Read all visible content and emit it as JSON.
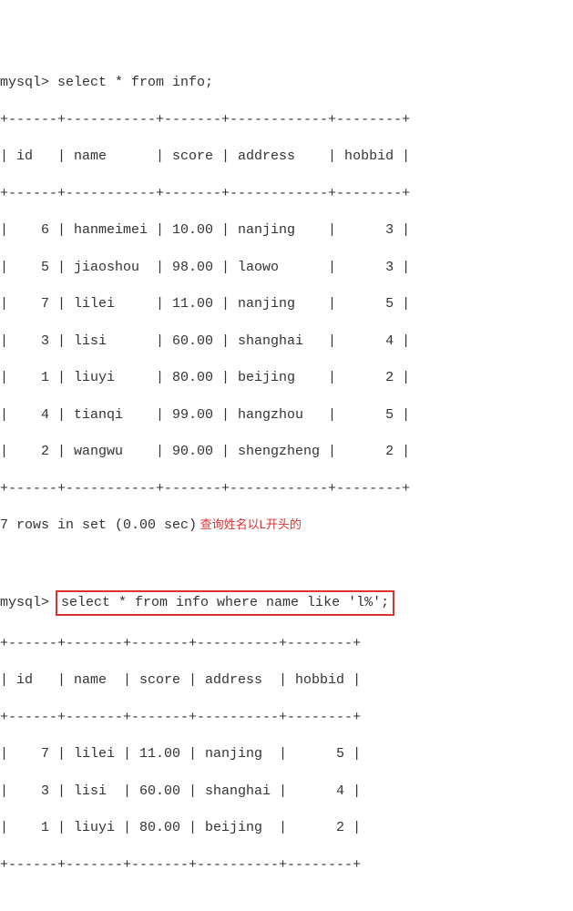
{
  "prompt1": "mysql> ",
  "query1": "select * from info;",
  "table1": {
    "border_top": "+------+-----------+-------+------------+--------+",
    "header_row": "| id   | name      | score | address    | hobbid |",
    "border_mid": "+------+-----------+-------+------------+--------+",
    "rows": [
      "|    6 | hanmeimei | 10.00 | nanjing    |      3 |",
      "|    5 | jiaoshou  | 98.00 | laowo      |      3 |",
      "|    7 | lilei     | 11.00 | nanjing    |      5 |",
      "|    3 | lisi      | 60.00 | shanghai   |      4 |",
      "|    1 | liuyi     | 80.00 | beijing    |      2 |",
      "|    4 | tianqi    | 99.00 | hangzhou   |      5 |",
      "|    2 | wangwu    | 90.00 | shengzheng |      2 |"
    ],
    "border_bot": "+------+-----------+-------+------------+--------+"
  },
  "result_count1": "7 rows in set (0.00 sec)",
  "annotation": " 查询姓名以L开头的",
  "prompt2": "mysql> ",
  "query2": "select * from info where name like 'l%';",
  "table2": {
    "border_top": "+------+-------+-------+----------+--------+",
    "header_row": "| id   | name  | score | address  | hobbid |",
    "border_mid": "+------+-------+-------+----------+--------+",
    "rows": [
      "|    7 | lilei | 11.00 | nanjing  |      5 |",
      "|    3 | lisi  | 60.00 | shanghai |      4 |",
      "|    1 | liuyi | 80.00 | beijing  |      2 |"
    ],
    "border_bot": "+------+-------+-------+----------+--------+"
  },
  "chart_data": {
    "type": "table",
    "tables": [
      {
        "query": "select * from info;",
        "columns": [
          "id",
          "name",
          "score",
          "address",
          "hobbid"
        ],
        "rows": [
          [
            6,
            "hanmeimei",
            10.0,
            "nanjing",
            3
          ],
          [
            5,
            "jiaoshou",
            98.0,
            "laowo",
            3
          ],
          [
            7,
            "lilei",
            11.0,
            "nanjing",
            5
          ],
          [
            3,
            "lisi",
            60.0,
            "shanghai",
            4
          ],
          [
            1,
            "liuyi",
            80.0,
            "beijing",
            2
          ],
          [
            4,
            "tianqi",
            99.0,
            "hangzhou",
            5
          ],
          [
            2,
            "wangwu",
            90.0,
            "shengzheng",
            2
          ]
        ],
        "row_count_text": "7 rows in set (0.00 sec)"
      },
      {
        "query": "select * from info where name like 'l%';",
        "columns": [
          "id",
          "name",
          "score",
          "address",
          "hobbid"
        ],
        "rows": [
          [
            7,
            "lilei",
            11.0,
            "nanjing",
            5
          ],
          [
            3,
            "lisi",
            60.0,
            "shanghai",
            4
          ],
          [
            1,
            "liuyi",
            80.0,
            "beijing",
            2
          ]
        ]
      }
    ],
    "annotation_text": "查询姓名以L开头的",
    "annotation_translation_hint": "Query names starting with L"
  }
}
